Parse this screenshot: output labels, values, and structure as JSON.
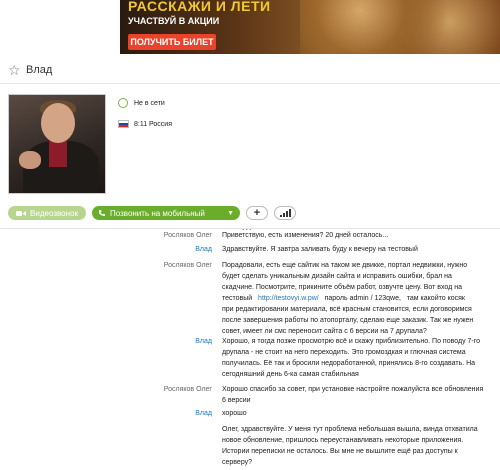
{
  "banner": {
    "headline": "РАССКАЖИ И ЛЕТИ",
    "subtitle": "УЧАСТВУЙ В АКЦИИ",
    "button": "ПОЛУЧИТЬ БИЛЕТ"
  },
  "contact": {
    "name": "Влад",
    "status": "Не в сети",
    "local_time": "8:11 Россия"
  },
  "actions": {
    "video_call": "Видеозвонок",
    "call_mobile": "Позвонить на мобильный",
    "add": "+"
  },
  "chat": {
    "more_indicator": "...",
    "messages": [
      {
        "sender": "Росляков Олег",
        "lines": [
          "Приветствую, есть изменения? 20 дней осталось..."
        ]
      },
      {
        "sender": "Влад",
        "lines": [
          "Здравствуйте. Я завтра заливать буду к вечеру на тестовый"
        ]
      },
      {
        "sender": "Росляков Олег",
        "lines": [
          "Порадовали, есть еще сайтик на таком же двикке, портал недвижки, нужно",
          "будет сделать уникальным дизайн сайта и исправить ошибки, брал на",
          "скадчине. Посмотрите, прикините объём работ, озвучте цену.   Вот вход на",
          "тестовый   ",
          "http://testovyi.w.pw/",
          "   пароль admin / 123qwe,   там какойто косяк",
          "при редактировании материала, всё красным становится, если договоримся",
          "после завершения работы по атопорталу, сделаю еще заказик. Так же нужен",
          "совет, имеет ли смс переносит сайта с 6  версии на 7 друпала?"
        ]
      },
      {
        "sender": "Влад",
        "lines": [
          "Хорошо, я тогда позже просмотрю всё и скажу приблизительно. По поводу 7-го",
          "друпала - не стоит на него переходить. Это громоздкая и глючная система",
          "получилась. Её так и бросили недоработанной, принялись 8-го создавать. На",
          "сегодняшний день 6-ка самая стабильная"
        ]
      },
      {
        "sender": "Росляков Олег",
        "lines": [
          "Хорошо спасибо за совет, при установке настройте пожалуйста все обновления",
          "6 версии"
        ]
      },
      {
        "sender": "Влад",
        "lines": [
          "хорошо"
        ]
      },
      {
        "sender": "",
        "lines": [
          "Олег, здравствуйте. У меня тут проблема небольшая вышла, винда отхватила",
          "новое обновление, пришлось переустанавливать некоторые приложения.",
          "Истории переписки не осталось. Вы мне не вышлите ещё раз доступы к",
          "серверу?"
        ]
      }
    ]
  },
  "colors": {
    "accent_green": "#6aac2c",
    "link_blue": "#1f78b8",
    "banner_yellow": "#f2c830",
    "banner_button": "#e9432b"
  },
  "icons": [
    "star-icon",
    "status-offline-icon",
    "russia-flag-icon",
    "video-camera-icon",
    "phone-icon",
    "plus-icon",
    "signal-icon"
  ]
}
